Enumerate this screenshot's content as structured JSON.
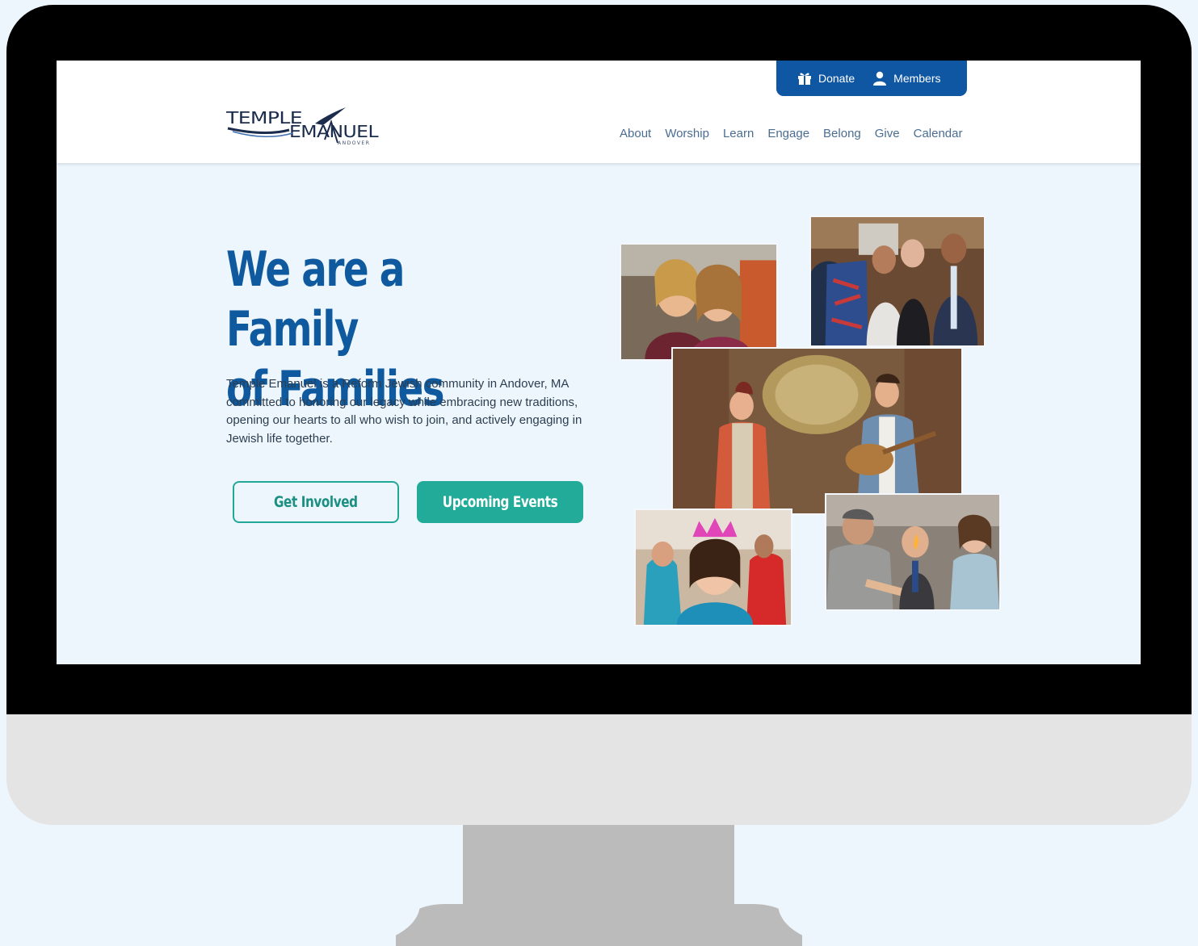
{
  "site": {
    "logo_top": "TEMPLE",
    "logo_bottom": "EMANUEL",
    "logo_sub": "ANDOVER"
  },
  "utility": {
    "donate_label": "Donate",
    "members_label": "Members"
  },
  "nav": {
    "items": [
      "About",
      "Worship",
      "Learn",
      "Engage",
      "Belong",
      "Give",
      "Calendar"
    ]
  },
  "hero": {
    "title_line1": "We are a Family",
    "title_line2": "of Families",
    "body": "Temple Emanuel is a Reform Jewish community in Andover, MA committed to honoring our legacy while embracing new traditions, opening our hearts to all who wish to join, and actively engaging in Jewish life together.",
    "cta_primary": "Get Involved",
    "cta_secondary": "Upcoming Events"
  },
  "colors": {
    "brand_blue": "#0f56a3",
    "teal": "#22ab98",
    "page_bg": "#eef6fd"
  }
}
